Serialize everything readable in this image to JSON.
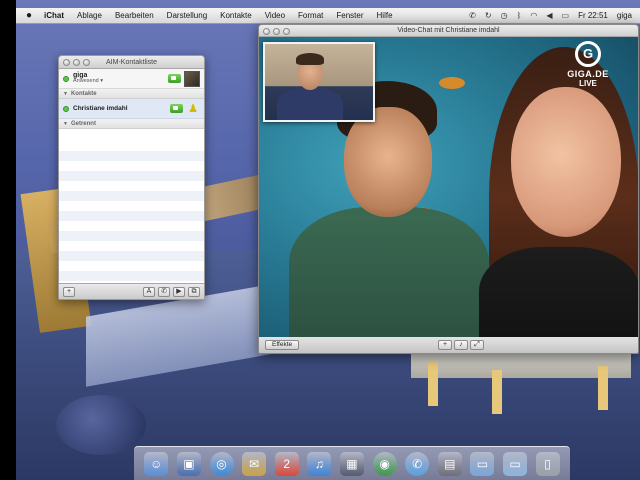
{
  "menubar": {
    "apple": "",
    "app": "iChat",
    "items": [
      "Ablage",
      "Bearbeiten",
      "Darstellung",
      "Kontakte",
      "Video",
      "Format",
      "Fenster",
      "Hilfe"
    ],
    "clock": "Fr 22:51",
    "user": "giga"
  },
  "buddy_list": {
    "title": "AIM-Kontaktliste",
    "me": {
      "name": "giga",
      "status": "Anwesend ▾"
    },
    "groups": [
      {
        "label": "Kontakte",
        "contacts": [
          {
            "name": "Christiane imdahl"
          }
        ]
      },
      {
        "label": "Getrennt"
      }
    ],
    "toolbar": {
      "add": "+",
      "text": "A",
      "phone": "✆",
      "video": "▶",
      "screen": "⧉"
    }
  },
  "video_chat": {
    "title": "Video-Chat mit Christiane imdahl",
    "end_button": "Effekte",
    "toolbar_icons": [
      "+",
      "🎙",
      "⤢"
    ]
  },
  "overlay": {
    "logo_letter": "G",
    "logo_name": "GIGA.DE",
    "logo_live": "LIVE"
  },
  "dock": {
    "items": [
      {
        "icon": "finder-icon",
        "glyph": "☺",
        "color": "#5b8fd8"
      },
      {
        "icon": "preview-icon",
        "glyph": "▣",
        "color": "#4a6fb0"
      },
      {
        "icon": "safari-icon",
        "glyph": "◎",
        "color": "#3c8ad8"
      },
      {
        "icon": "mail-icon",
        "glyph": "✉",
        "color": "#c9a24a"
      },
      {
        "icon": "ical-icon",
        "glyph": "2",
        "color": "#d94a3a"
      },
      {
        "icon": "itunes-icon",
        "glyph": "♫",
        "color": "#3f84d6"
      },
      {
        "icon": "frontrow-icon",
        "glyph": "▦",
        "color": "#555c6e"
      },
      {
        "icon": "timemachine-icon",
        "glyph": "◉",
        "color": "#3b9a4a"
      },
      {
        "icon": "ichat-icon",
        "glyph": "✆",
        "color": "#5aa0e0"
      },
      {
        "icon": "photobooth-icon",
        "glyph": "▤",
        "color": "#6e6e78"
      },
      {
        "icon": "folder-icon",
        "glyph": "▭",
        "color": "#7aa7d8"
      },
      {
        "icon": "downloads-icon",
        "glyph": "▭",
        "color": "#8eb4de"
      },
      {
        "icon": "trash-icon",
        "glyph": "▯",
        "color": "#9aa0a8"
      }
    ]
  }
}
